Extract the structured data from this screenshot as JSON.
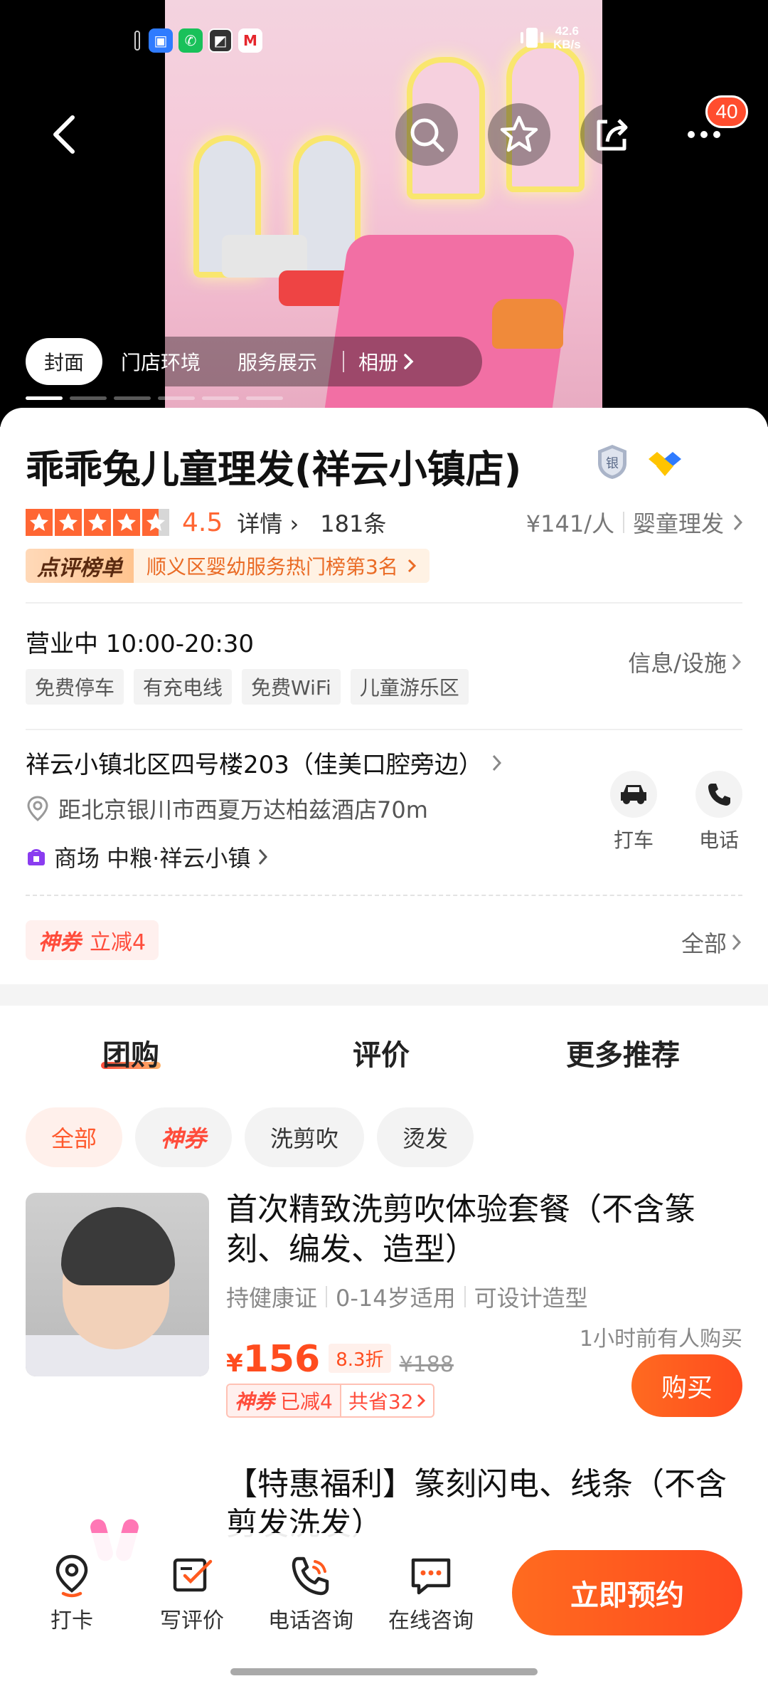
{
  "status_bar": {
    "net_speed_value": "42.6",
    "net_speed_unit": "KB/s",
    "apps": [
      "app-blue",
      "app-green-phone",
      "app-dark",
      "app-red"
    ]
  },
  "hero": {
    "badge_count": "40",
    "tabs": [
      {
        "label": "封面"
      },
      {
        "label": "门店环境"
      },
      {
        "label": "服务展示"
      },
      {
        "label": "相册"
      }
    ]
  },
  "shop": {
    "title": "乖乖兔儿童理发(祥云小镇店)",
    "medal_text": "银",
    "rating": "4.5",
    "details_label": "详情",
    "review_count": "181条",
    "price_per_person": "¥141/人",
    "category": "婴童理发",
    "rank_tag_left": "点评榜单",
    "rank_tag_right": "顺义区婴幼服务热门榜第3名",
    "hours": "营业中 10:00-20:30",
    "facilities": [
      "免费停车",
      "有充电线",
      "免费WiFi",
      "儿童游乐区"
    ],
    "info_link": "信息/设施",
    "address": "祥云小镇北区四号楼203（佳美口腔旁边）",
    "distance": "距北京银川市西夏万达柏兹酒店70m",
    "mall": "商场 中粮·祥云小镇",
    "taxi_label": "打车",
    "phone_label": "电话",
    "coupon_brand": "神券",
    "coupon_text": "立减4",
    "all_label": "全部"
  },
  "section_tabs": [
    "团购",
    "评价",
    "更多推荐"
  ],
  "filter_chips": [
    "全部",
    "神券",
    "洗剪吹",
    "烫发"
  ],
  "deals": [
    {
      "title": "首次精致洗剪吹体验套餐（不含篆刻、编发、造型）",
      "meta": [
        "持健康证",
        "0-14岁适用",
        "可设计造型"
      ],
      "recent": "1小时前有人购买",
      "price": "156",
      "discount": "8.3折",
      "original_price": "¥188",
      "coupon_brand": "神券",
      "coupon_applied": "已减4",
      "saved": "共省32",
      "buy_label": "购买"
    },
    {
      "title": "【特惠福利】篆刻闪电、线条（不含剪发洗发）"
    }
  ],
  "bottom_bar": {
    "items": [
      {
        "label": "打卡",
        "icon": "location-pin-icon"
      },
      {
        "label": "写评价",
        "icon": "write-review-icon"
      },
      {
        "label": "电话咨询",
        "icon": "phone-call-icon"
      },
      {
        "label": "在线咨询",
        "icon": "chat-icon"
      }
    ],
    "reserve_label": "立即预约"
  },
  "colors": {
    "accent": "#ff5a1f",
    "star": "#ff6633",
    "coupon_red": "#ff4c3b"
  }
}
